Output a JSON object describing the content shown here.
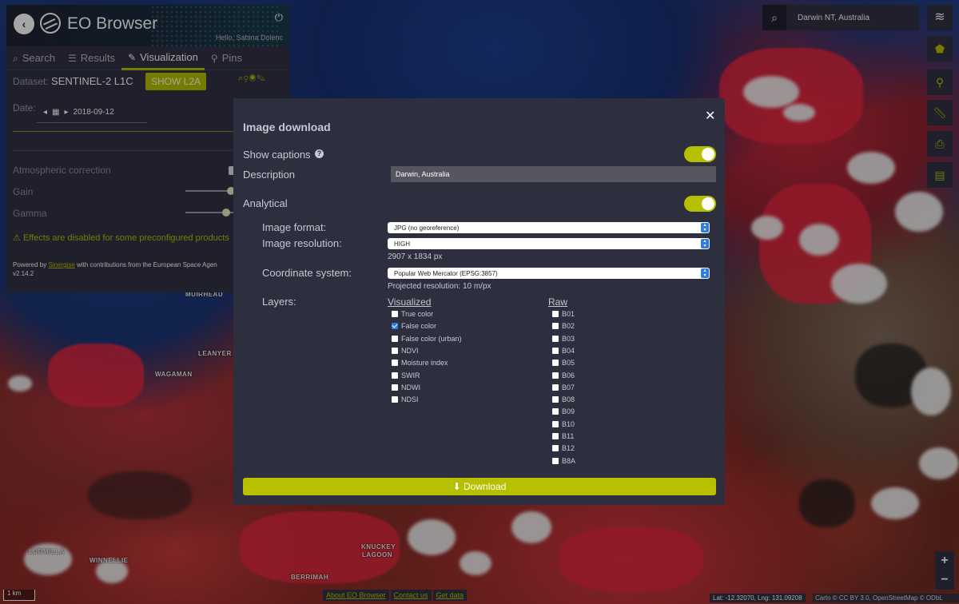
{
  "app": {
    "title": "EO Browser",
    "greeting": "Hello, Sabina Dolenc",
    "back_icon": "chevron-left-icon",
    "power_icon": "power-icon"
  },
  "tabs": [
    {
      "label": "Search",
      "icon": "search-icon"
    },
    {
      "label": "Results",
      "icon": "sliders-icon"
    },
    {
      "label": "Visualization",
      "icon": "brush-icon",
      "active": true
    },
    {
      "label": "Pins",
      "icon": "pin-icon"
    }
  ],
  "dataset": {
    "label": "Dataset:",
    "name": "SENTINEL-2 L1C",
    "show_l2a": "SHOW L2A"
  },
  "date": {
    "label": "Date:",
    "value": "2018-09-12"
  },
  "effects": {
    "atmospheric": "Atmospheric correction",
    "gain": "Gain",
    "gamma": "Gamma",
    "gain_level": 0.95,
    "gamma_level": 0.85,
    "warning": "Effects are disabled for some preconfigured products"
  },
  "powered_by": {
    "prefix": "Powered by",
    "link": "Sinergise",
    "suffix": "with contributions from the European Space Agen",
    "version": "v2.14.2"
  },
  "search": {
    "value": "Darwin NT, Australia"
  },
  "map_labels": [
    "MUIRHEAD",
    "LEANYER",
    "WAGAMAN",
    "WINNELLIE",
    "LUDMILLA",
    "KNUCKEY LAGOON",
    "BERRIMAH"
  ],
  "footer": {
    "scale": "1 km",
    "links": [
      "About EO Browser",
      "Contact us",
      "Get data"
    ],
    "coords": "Lat: -12.32070, Lng: 131.09208",
    "attribution": "Carto © CC BY 3.0, OpenStreetMap © ODbL"
  },
  "modal": {
    "title": "Image download",
    "show_captions": "Show captions",
    "description_label": "Description",
    "description_value": "Darwin, Australia",
    "analytical": "Analytical",
    "image_format_label": "Image format:",
    "image_format_value": "JPG (no georeference)",
    "image_resolution_label": "Image resolution:",
    "image_resolution_value": "HIGH",
    "resolution_px": "2907 x 1834 px",
    "coordinate_system_label": "Coordinate system:",
    "coordinate_system_value": "Popular Web Mercator (EPSG:3857)",
    "projected_resolution": "Projected resolution: 10 m/px",
    "layers_label": "Layers:",
    "visualized_head": "Visualized",
    "raw_head": "Raw",
    "visualized": [
      {
        "label": "True color",
        "checked": false
      },
      {
        "label": "False color",
        "checked": true
      },
      {
        "label": "False color (urban)",
        "checked": false
      },
      {
        "label": "NDVI",
        "checked": false
      },
      {
        "label": "Moisture index",
        "checked": false
      },
      {
        "label": "SWIR",
        "checked": false
      },
      {
        "label": "NDWI",
        "checked": false
      },
      {
        "label": "NDSI",
        "checked": false
      }
    ],
    "raw": [
      "B01",
      "B02",
      "B03",
      "B04",
      "B05",
      "B06",
      "B07",
      "B08",
      "B09",
      "B10",
      "B11",
      "B12",
      "B8A"
    ],
    "download_label": "Download"
  },
  "colors": {
    "accent": "#b6bf00",
    "panel": "#303243",
    "modal": "#2d2f3f"
  }
}
